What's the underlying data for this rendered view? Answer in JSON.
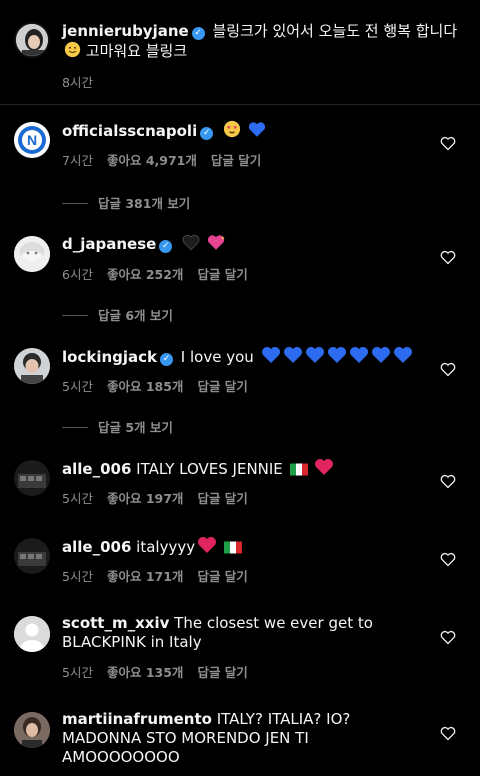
{
  "caption": {
    "username": "jennierubyjane",
    "text_line1": "블링크가 있어서 오늘도 전 행복 합니다",
    "text_line2": "고마워요 블링크",
    "time": "8시간"
  },
  "labels": {
    "likes_prefix": "좋아요",
    "likes_suffix": "개",
    "reply": "답글 달기"
  },
  "comments": [
    {
      "username": "officialsscnapoli",
      "verified": true,
      "text": "",
      "time": "7시간",
      "likes": "4,971",
      "replies": "답글 381개 보기"
    },
    {
      "username": "d_japanese",
      "verified": true,
      "text": "",
      "time": "6시간",
      "likes": "252",
      "replies": "답글 6개 보기"
    },
    {
      "username": "lockingjack",
      "verified": true,
      "text": "I love you",
      "time": "5시간",
      "likes": "185",
      "replies": "답글 5개 보기"
    },
    {
      "username": "alle_006",
      "verified": false,
      "text": "ITALY LOVES JENNIE",
      "time": "5시간",
      "likes": "197"
    },
    {
      "username": "alle_006",
      "verified": false,
      "text": "italyyyy",
      "time": "5시간",
      "likes": "171"
    },
    {
      "username": "scott_m_xxiv",
      "verified": false,
      "text": "The closest we ever get to",
      "text2": "BLACKPINK in Italy",
      "time": "5시간",
      "likes": "135"
    },
    {
      "username": "martiinafrumento",
      "verified": false,
      "text": "ITALY? ITALIA? IO?",
      "text2": "MADONNA STO MORENDO JEN TI",
      "text3": "AMOOOOOOOO"
    }
  ],
  "colors": {
    "background": "#000000",
    "text": "#f5f5f5",
    "muted": "#8e8e8e",
    "verified": "#3897f0",
    "heart_red": "#e0245e",
    "blue_heart": "#2d6bf0"
  }
}
